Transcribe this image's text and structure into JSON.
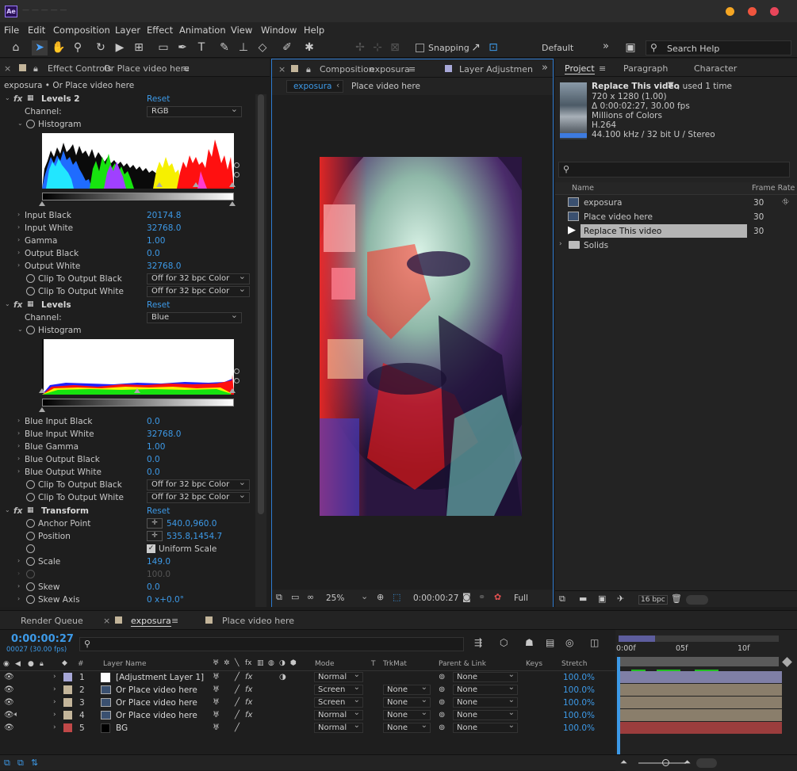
{
  "app": {
    "icon": "Ae",
    "title": "— — — — —"
  },
  "menu": [
    "File",
    "Edit",
    "Composition",
    "Layer",
    "Effect",
    "Animation",
    "View",
    "Window",
    "Help"
  ],
  "toolbar": {
    "snapping": "Snapping",
    "workspace": "Default",
    "search_placeholder": "Search Help"
  },
  "effect_controls": {
    "tab_prefix": "Effect Controls",
    "tab_layer": "Or Place video here",
    "breadcrumb": "exposura • Or Place video here",
    "reset": "Reset",
    "levels2": {
      "name": "Levels 2",
      "channel_label": "Channel:",
      "channel_value": "RGB",
      "histogram": "Histogram",
      "props": [
        {
          "label": "Input Black",
          "value": "20174.8"
        },
        {
          "label": "Input White",
          "value": "32768.0"
        },
        {
          "label": "Gamma",
          "value": "1.00"
        },
        {
          "label": "Output Black",
          "value": "0.0"
        },
        {
          "label": "Output White",
          "value": "32768.0"
        }
      ],
      "clip_black": "Clip To Output Black",
      "clip_white": "Clip To Output White",
      "clip_value": "Off for 32 bpc Color"
    },
    "levels": {
      "name": "Levels",
      "channel_label": "Channel:",
      "channel_value": "Blue",
      "histogram": "Histogram",
      "props": [
        {
          "label": "Blue Input Black",
          "value": "0.0"
        },
        {
          "label": "Blue Input White",
          "value": "32768.0"
        },
        {
          "label": "Blue Gamma",
          "value": "1.00"
        },
        {
          "label": "Blue Output Black",
          "value": "0.0"
        },
        {
          "label": "Blue Output White",
          "value": "0.0"
        }
      ],
      "clip_black": "Clip To Output Black",
      "clip_white": "Clip To Output White",
      "clip_value": "Off for 32 bpc Color"
    },
    "transform": {
      "name": "Transform",
      "anchor_label": "Anchor Point",
      "anchor_value": "540.0,960.0",
      "position_label": "Position",
      "position_value": "535.8,1454.7",
      "uniform_scale": "Uniform Scale",
      "scale_label": "Scale",
      "scale_value": "149.0",
      "unnamed_value": "100.0",
      "skew_label": "Skew",
      "skew_value": "0.0",
      "skew_axis_label": "Skew Axis",
      "skew_axis_value": "0 x+0.0°"
    }
  },
  "composition": {
    "tab_prefix": "Composition",
    "tab_name": "exposura",
    "layer_tab": "Layer Adjustmen",
    "crumb_active": "exposura",
    "crumb_next": "Place video here",
    "zoom": "25%",
    "timecode": "0:00:00:27",
    "resolution": "Full"
  },
  "project": {
    "tabs": [
      "Project",
      "Paragraph",
      "Character"
    ],
    "item_name": "Replace This video",
    "used": ", used 1 time",
    "info": [
      "720 x 1280 (1.00)",
      "Δ 0:00:02:27, 30.00 fps",
      "Millions of Colors",
      "H.264",
      "44.100 kHz / 32 bit U / Stereo"
    ],
    "col_name": "Name",
    "col_fps": "Frame Rate",
    "items": [
      {
        "name": "exposura",
        "fps": "30"
      },
      {
        "name": "Place video here",
        "fps": "30"
      },
      {
        "name": "Replace This video",
        "fps": "30"
      },
      {
        "name": "Solids",
        "fps": ""
      }
    ],
    "bpc": "16 bpc"
  },
  "timeline": {
    "tabs": [
      "Render Queue",
      "exposura",
      "Place video here"
    ],
    "timecode": "0:00:00:27",
    "timecode_sub": "00027 (30.00 fps)",
    "search_placeholder": "",
    "headers": {
      "num": "#",
      "layer_name": "Layer Name",
      "mode": "Mode",
      "t": "T",
      "trkmat": "TrkMat",
      "parent": "Parent & Link",
      "keys": "Keys",
      "stretch": "Stretch"
    },
    "ruler": [
      "0:00f",
      "05f",
      "10f"
    ],
    "layers": [
      {
        "num": "1",
        "name": "[Adjustment Layer 1]",
        "mode": "Normal",
        "trkmat": "",
        "parent": "None",
        "stretch": "100.0%",
        "color": "#a8a8d8",
        "bar": "#7f7fa6"
      },
      {
        "num": "2",
        "name": "Or Place video here",
        "mode": "Screen",
        "trkmat": "None",
        "parent": "None",
        "stretch": "100.0%",
        "color": "#c3b59a",
        "bar": "#8a7e6b"
      },
      {
        "num": "3",
        "name": "Or Place video here",
        "mode": "Screen",
        "trkmat": "None",
        "parent": "None",
        "stretch": "100.0%",
        "color": "#c3b59a",
        "bar": "#8a7e6b"
      },
      {
        "num": "4",
        "name": "Or Place video here",
        "mode": "Normal",
        "trkmat": "None",
        "parent": "None",
        "stretch": "100.0%",
        "color": "#c3b59a",
        "bar": "#8a7e6b"
      },
      {
        "num": "5",
        "name": "BG",
        "mode": "Normal",
        "trkmat": "None",
        "parent": "None",
        "stretch": "100.0%",
        "color": "#c04848",
        "bar": "#9b3d3d"
      }
    ]
  }
}
